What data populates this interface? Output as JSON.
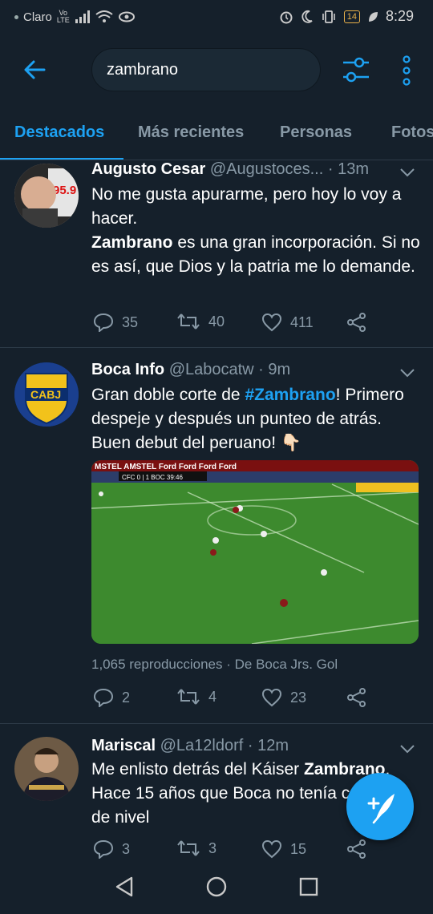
{
  "status_bar": {
    "carrier": "Claro",
    "volte_top": "Vo",
    "volte_bottom": "LTE",
    "battery": "14",
    "time": "8:29"
  },
  "header": {
    "search_value": "zambrano",
    "back_icon": "arrow-left-icon",
    "filter_icon": "sliders-icon",
    "more_icon": "vertical-dots-icon"
  },
  "tabs": [
    {
      "label": "Destacados",
      "active": true
    },
    {
      "label": "Más recientes",
      "active": false
    },
    {
      "label": "Personas",
      "active": false
    },
    {
      "label": "Fotos",
      "active": false
    }
  ],
  "tweets": [
    {
      "name": "Augusto Cesar",
      "handle": "@Augustoces...",
      "time": "· 13m",
      "body_line1": "No me gusta apurarme, pero hoy lo voy a hacer.",
      "body_bold": "Zambrano",
      "body_line2": " es una gran incorporación. Si no es así, que Dios y la patria me lo demande.",
      "replies": "35",
      "retweets": "40",
      "likes": "411"
    },
    {
      "name": "Boca Info",
      "handle": "@Labocatw",
      "time": "· 9m",
      "body_pre": "Gran doble corte de ",
      "hashtag": "#Zambrano",
      "body_post": "! Primero despeje y después un punteo de atrás. Buen debut del peruano! 👇🏻",
      "media_ads": "MSTEL   AMSTEL   Ford   Ford   Ford   Ford",
      "scorebug": "CFC 0 | 1 BOC   39:46",
      "views": "1,065 reproducciones",
      "source": "· De Boca Jrs. Gol",
      "replies": "2",
      "retweets": "4",
      "likes": "23"
    },
    {
      "name": "Mariscal",
      "handle": "@La12ldorf",
      "time": "· 12m",
      "body_pre": "Me enlisto detrás del Káiser ",
      "body_bold": "Zambrano",
      "body_post": ". Hace 15 años que Boca no tenía céntrales de nivel",
      "replies": "3",
      "retweets": "3",
      "likes": "15"
    }
  ],
  "avatars": {
    "tweet1_badge": "95.9",
    "tweet2_badge": "CABJ"
  },
  "colors": {
    "background": "#15202b",
    "accent": "#1da1f2",
    "secondary_text": "#8899a6",
    "divider": "#2d3b48"
  }
}
